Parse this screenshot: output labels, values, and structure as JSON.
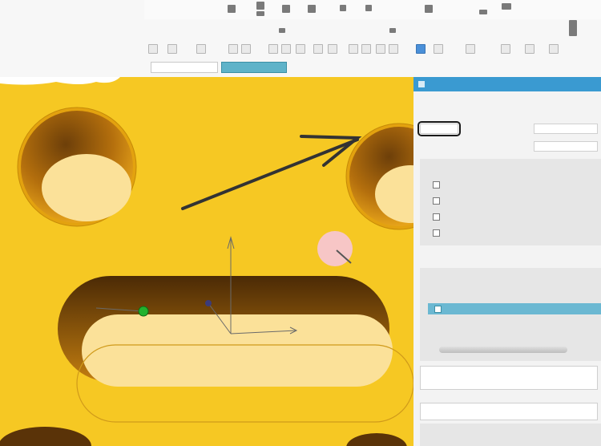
{
  "colors": {
    "viewport_bg": "#f6c823",
    "panel_header": "#3a9ad1",
    "selected_tab": "#5fb3c9",
    "hole_inner": "#fbe199",
    "hole_dark": "#6d3f09",
    "origin_point": "#22b22e",
    "highlight_dot": "#f7c6e3"
  },
  "icons": [
    "camera-view-icon",
    "rotate-icon",
    "zoom-icon",
    "pan-icon",
    "section-icon",
    "sketch-icon",
    "dimension-icon",
    "constraint-icon",
    "hole-icon",
    "mirror-icon",
    "pattern-icon",
    "measure-icon"
  ]
}
